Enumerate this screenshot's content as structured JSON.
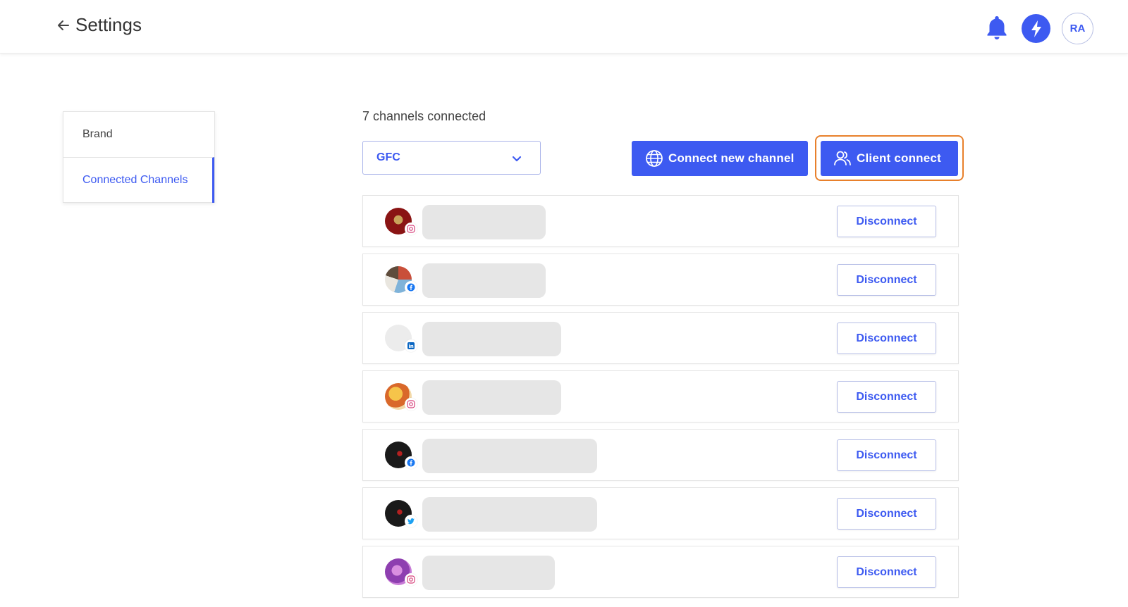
{
  "header": {
    "title": "Settings",
    "avatar_initials": "RA",
    "icons": [
      "back-arrow-icon",
      "bell-icon",
      "lightning-icon"
    ]
  },
  "sidebar": {
    "items": [
      {
        "label": "Brand",
        "active": false
      },
      {
        "label": "Connected Channels",
        "active": true
      }
    ]
  },
  "main": {
    "channel_count_text": "7 channels connected",
    "brand_select": {
      "value": "GFC"
    },
    "connect_new_label": "Connect new channel",
    "client_connect_label": "Client connect",
    "channels": [
      {
        "platform": "instagram",
        "disconnect_label": "Disconnect"
      },
      {
        "platform": "facebook",
        "disconnect_label": "Disconnect"
      },
      {
        "platform": "linkedin",
        "disconnect_label": "Disconnect"
      },
      {
        "platform": "instagram",
        "disconnect_label": "Disconnect"
      },
      {
        "platform": "facebook",
        "disconnect_label": "Disconnect"
      },
      {
        "platform": "twitter",
        "disconnect_label": "Disconnect"
      },
      {
        "platform": "instagram",
        "disconnect_label": "Disconnect"
      }
    ]
  },
  "colors": {
    "accent": "#3d5af1",
    "highlight": "#e8802b",
    "placeholder": "#e6e6e6"
  }
}
